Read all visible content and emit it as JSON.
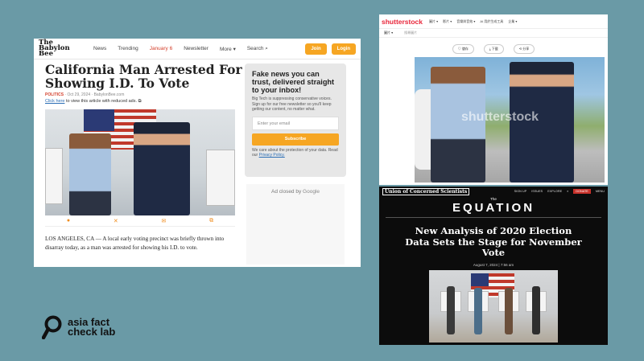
{
  "bee": {
    "logo": "The Babylon Bee",
    "nav": [
      "News",
      "Trending",
      "January 6",
      "Newsletter",
      "More ▾",
      "Search"
    ],
    "join": "Join",
    "login": "Login",
    "title": "California Man Arrested For Showing I.D. To Vote",
    "category": "POLITICS",
    "meta": " · Oct 29, 2024 · BabylonBee.com",
    "reduced_link": "Click here",
    "reduced_text": " to view this article with reduced ads.",
    "body": "LOS ANGELES, CA — A local early voting precinct was briefly thrown into disarray today, as a man was arrested for showing his I.D. to vote.",
    "side_title": "Fake news you can trust, delivered straight to your inbox!",
    "side_text": "Big Tech is suppressing conservative voices. Sign up for our free newsletter so you'll keep getting our content, no matter what.",
    "email_placeholder": "Enter your email",
    "subscribe": "Subscribe",
    "privacy_text": "We care about the protection of your data. Read our ",
    "privacy_link": "Privacy Policy.",
    "ad_closed": "Ad closed by ",
    "ad_brand": "Google"
  },
  "shutterstock": {
    "logo": "shutterstock",
    "menu": [
      "圖片 ▾",
      "影片 ▾",
      "音樂與音效 ▾",
      "AI 用於生成工具",
      "企業 ▾"
    ],
    "search_type": "圖片 ▾",
    "search_placeholder": "搜尋圖片",
    "actions": [
      "♡ 儲存",
      "⤓ 下載",
      "⟲ 分享"
    ],
    "watermark": "shutterstock"
  },
  "equation": {
    "brand": "Union of Concerned Scientists",
    "menu": [
      "SIGN UP",
      "ISSUES",
      "EXPLORE"
    ],
    "donate": "DONATE",
    "menu_end": "MENU",
    "the": "The",
    "name": "EQUATION",
    "headline": "New Analysis of 2020 Election Data Sets the Stage for November Vote",
    "date": "August 7, 2024 | 7:56 am"
  },
  "logo": {
    "line1": "asia fact",
    "line2": "check lab"
  }
}
